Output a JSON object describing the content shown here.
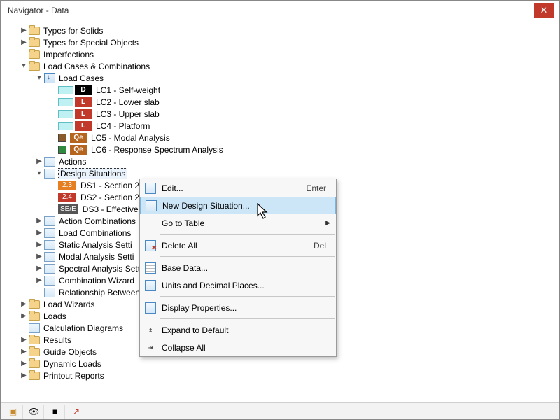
{
  "window": {
    "title": "Navigator - Data"
  },
  "tree": {
    "types_solids": "Types for Solids",
    "types_special": "Types for Special Objects",
    "imperfections": "Imperfections",
    "lcc": "Load Cases & Combinations",
    "load_cases": "Load Cases",
    "lc": [
      {
        "badge": "D",
        "label": "LC1 - Self-weight"
      },
      {
        "badge": "L",
        "label": "LC2 - Lower slab"
      },
      {
        "badge": "L",
        "label": "LC3 - Upper slab"
      },
      {
        "badge": "L",
        "label": "LC4 - Platform"
      },
      {
        "badge": "Qe",
        "label": "LC5 - Modal Analysis"
      },
      {
        "badge": "Qe",
        "label": "LC6 - Response Spectrum Analysis"
      }
    ],
    "actions": "Actions",
    "design_situations": "Design Situations",
    "ds": [
      {
        "badge": "2.3",
        "label": "DS1 - Section 2"
      },
      {
        "badge": "2.4",
        "label": "DS2 - Section 2"
      },
      {
        "badge": "SE/E",
        "label": "DS3 - Effective"
      }
    ],
    "action_combos": "Action Combinations",
    "load_combos": "Load Combinations",
    "static_settings": "Static Analysis Setti",
    "modal_settings": "Modal Analysis Setti",
    "spectral_settings": "Spectral Analysis Sett",
    "combo_wizard": "Combination Wizard",
    "rel_between": "Relationship Between",
    "load_wizards": "Load Wizards",
    "loads": "Loads",
    "calc_diagrams": "Calculation Diagrams",
    "results": "Results",
    "guide_objects": "Guide Objects",
    "dynamic_loads": "Dynamic Loads",
    "printout": "Printout Reports"
  },
  "context_menu": {
    "edit": "Edit...",
    "edit_shortcut": "Enter",
    "new_ds": "New Design Situation...",
    "go_table": "Go to Table",
    "delete_all": "Delete All",
    "delete_shortcut": "Del",
    "base_data": "Base Data...",
    "units": "Units and Decimal Places...",
    "display_props": "Display Properties...",
    "expand": "Expand to Default",
    "collapse": "Collapse All"
  }
}
